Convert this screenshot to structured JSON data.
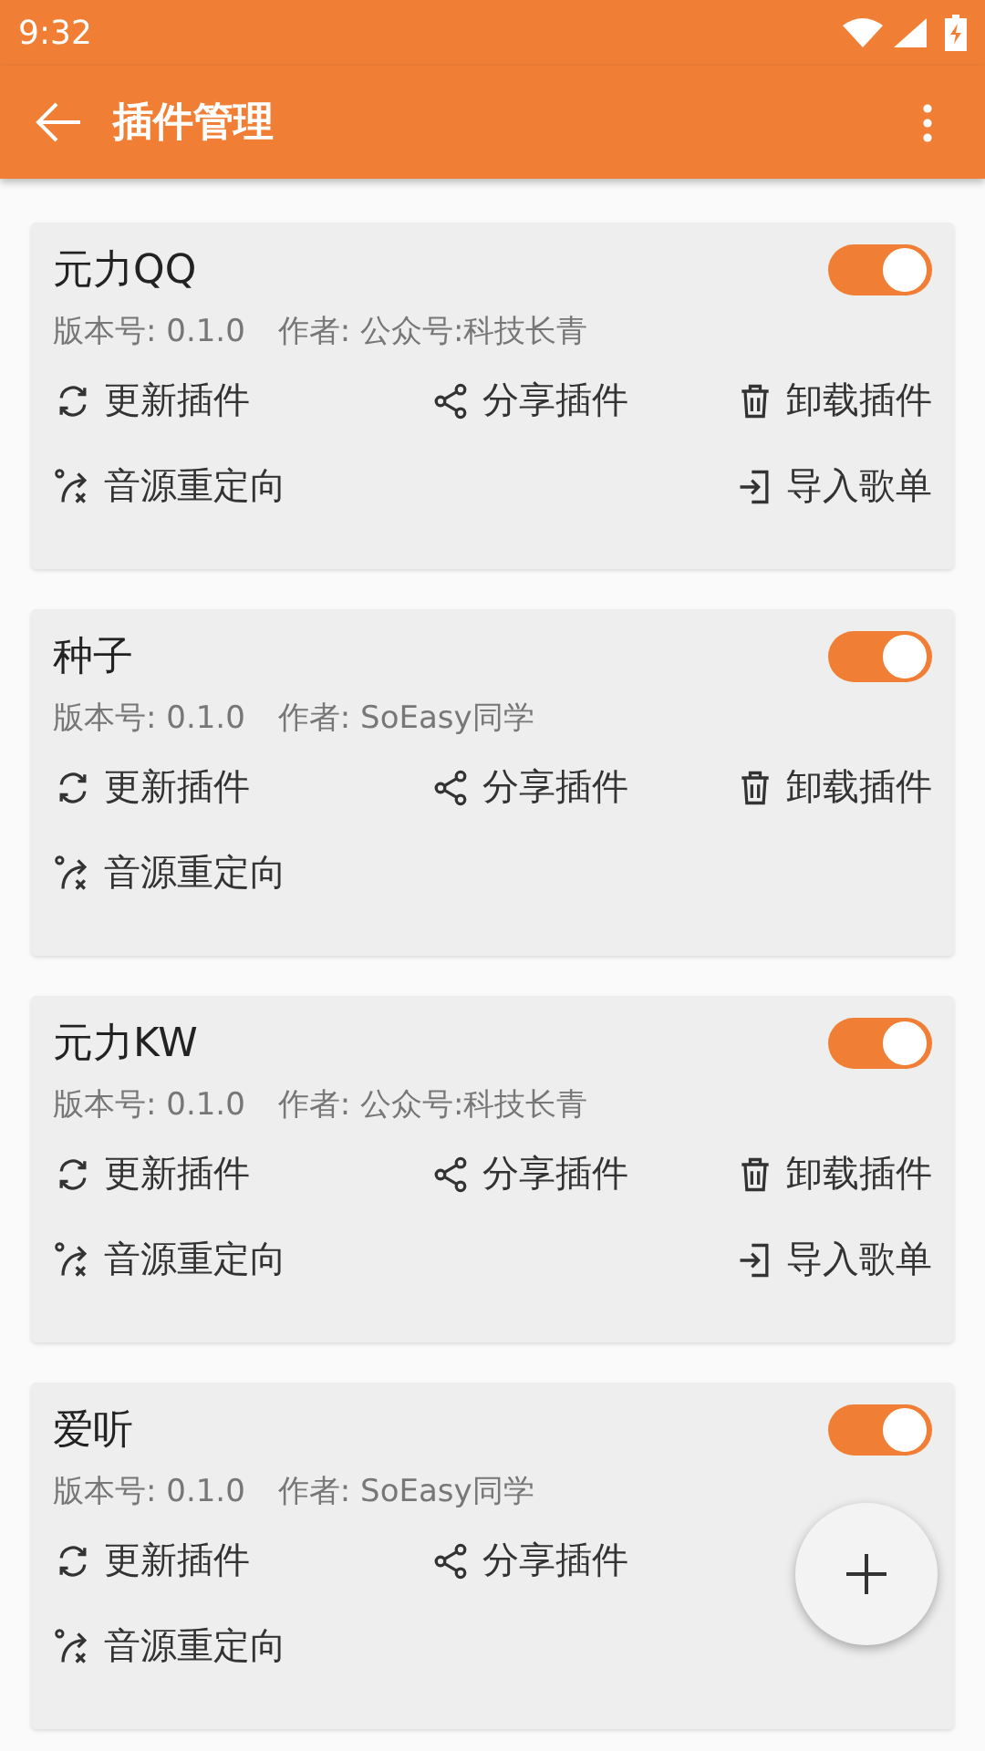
{
  "status_bar": {
    "time": "9:32"
  },
  "app_bar": {
    "title": "插件管理"
  },
  "plugins": [
    {
      "name": "元力QQ",
      "enabled": true,
      "version": "版本号: 0.1.0",
      "author": "作者: 公众号:科技长青",
      "actions": [
        {
          "kind": "update",
          "label": "更新插件"
        },
        {
          "kind": "share",
          "label": "分享插件"
        },
        {
          "kind": "uninstall",
          "label": "卸载插件"
        },
        {
          "kind": "redirect",
          "label": "音源重定向"
        },
        {
          "kind": "import",
          "label": "导入歌单"
        }
      ]
    },
    {
      "name": "种子",
      "enabled": true,
      "version": "版本号: 0.1.0",
      "author": "作者: SoEasy同学",
      "actions": [
        {
          "kind": "update",
          "label": "更新插件"
        },
        {
          "kind": "share",
          "label": "分享插件"
        },
        {
          "kind": "uninstall",
          "label": "卸载插件"
        },
        {
          "kind": "redirect",
          "label": "音源重定向"
        }
      ]
    },
    {
      "name": "元力KW",
      "enabled": true,
      "version": "版本号: 0.1.0",
      "author": "作者: 公众号:科技长青",
      "actions": [
        {
          "kind": "update",
          "label": "更新插件"
        },
        {
          "kind": "share",
          "label": "分享插件"
        },
        {
          "kind": "uninstall",
          "label": "卸载插件"
        },
        {
          "kind": "redirect",
          "label": "音源重定向"
        },
        {
          "kind": "import",
          "label": "导入歌单"
        }
      ]
    },
    {
      "name": "爱听",
      "enabled": true,
      "version": "版本号: 0.1.0",
      "author": "作者: SoEasy同学",
      "actions": [
        {
          "kind": "update",
          "label": "更新插件"
        },
        {
          "kind": "share",
          "label": "分享插件"
        },
        {
          "kind": "redirect",
          "label": "音源重定向"
        }
      ]
    }
  ]
}
